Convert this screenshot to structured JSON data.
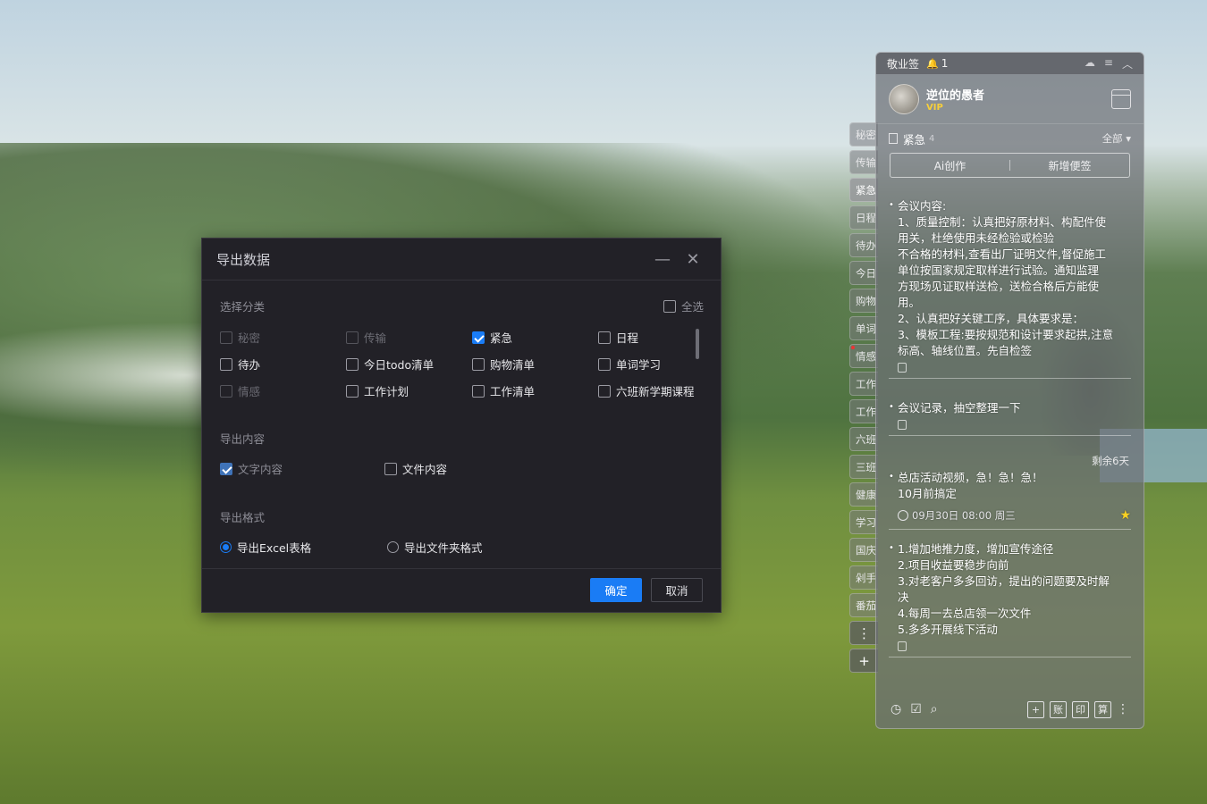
{
  "dialog": {
    "title": "导出数据",
    "select_category_label": "选择分类",
    "select_all": "全选",
    "categories": [
      {
        "label": "秘密",
        "checked": false,
        "disabled": true
      },
      {
        "label": "传输",
        "checked": false,
        "disabled": true
      },
      {
        "label": "紧急",
        "checked": true,
        "disabled": false
      },
      {
        "label": "日程",
        "checked": false,
        "disabled": false
      },
      {
        "label": "待办",
        "checked": false,
        "disabled": false
      },
      {
        "label": "今日todo清单",
        "checked": false,
        "disabled": false
      },
      {
        "label": "购物清单",
        "checked": false,
        "disabled": false
      },
      {
        "label": "单词学习",
        "checked": false,
        "disabled": false
      },
      {
        "label": "情感",
        "checked": false,
        "disabled": true
      },
      {
        "label": "工作计划",
        "checked": false,
        "disabled": false
      },
      {
        "label": "工作清单",
        "checked": false,
        "disabled": false
      },
      {
        "label": "六班新学期课程",
        "checked": false,
        "disabled": false
      }
    ],
    "export_content_label": "导出内容",
    "content_text": "文字内容",
    "content_file": "文件内容",
    "export_format_label": "导出格式",
    "format_excel": "导出Excel表格",
    "format_folder": "导出文件夹格式",
    "ok": "确定",
    "cancel": "取消"
  },
  "side_tabs": [
    "秘密",
    "传输",
    "紧急",
    "日程",
    "待办",
    "今日",
    "购物",
    "单词",
    "情感",
    "工作",
    "工作",
    "六班",
    "三班",
    "健康",
    "学习",
    "国庆",
    "剁手",
    "番茄"
  ],
  "side_tab_buttons": {
    "more": "⋮",
    "add": "+"
  },
  "panel": {
    "app_name": "敬业签",
    "notify_count": "1",
    "username": "逆位的愚者",
    "vip": "VIP",
    "category": "紧急",
    "category_count": "4",
    "filter": "全部",
    "ai_create": "Ai创作",
    "new_note": "新增便签",
    "remaining": "剩余6天",
    "notes": [
      {
        "lines": [
          "会议内容:",
          "1、质量控制：认真把好原材料、构配件使",
          "用关，杜绝使用未经检验或检验",
          "不合格的材料,查看出厂证明文件,督促施工",
          "单位按国家规定取样进行试验。通知监理",
          "方现场见证取样送检，送检合格后方能使",
          "用。",
          "2、认真把好关键工序，具体要求是：",
          "3、模板工程:要按规范和设计要求起拱,注意",
          "标高、轴线位置。先自检签"
        ]
      },
      {
        "lines": [
          "会议记录，抽空整理一下"
        ]
      },
      {
        "lines": [
          "总店活动视频，急！急！急！",
          "10月前搞定"
        ],
        "reminder": "09月30日 08:00 周三"
      },
      {
        "lines": [
          "1.增加地推力度，增加宣传途径",
          "2.项目收益要稳步向前",
          "3.对老客户多多回访，提出的问题要及时解",
          "决",
          "4.每周一去总店领一次文件",
          "5.多多开展线下活动"
        ]
      }
    ],
    "footer_buttons": [
      "+",
      "账",
      "印",
      "算"
    ]
  }
}
